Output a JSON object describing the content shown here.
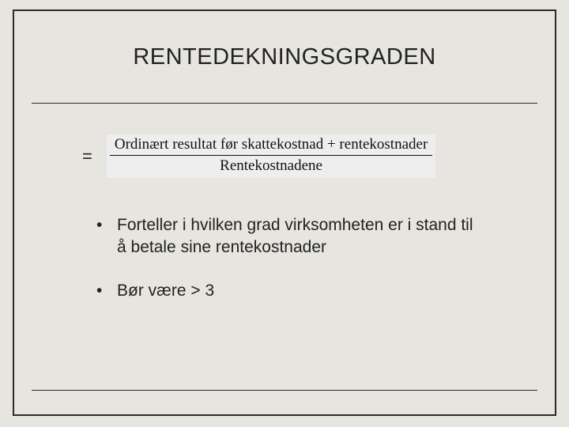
{
  "title": "RENTEDEKNINGSGRADEN",
  "formula": {
    "equals": "=",
    "numerator": "Ordinært resultat før skattekostnad + rentekostnader",
    "denominator": "Rentekostnadene"
  },
  "bullets": [
    "Forteller i hvilken grad virksomheten er i stand til å betale sine rentekostnader",
    "Bør være > 3"
  ]
}
